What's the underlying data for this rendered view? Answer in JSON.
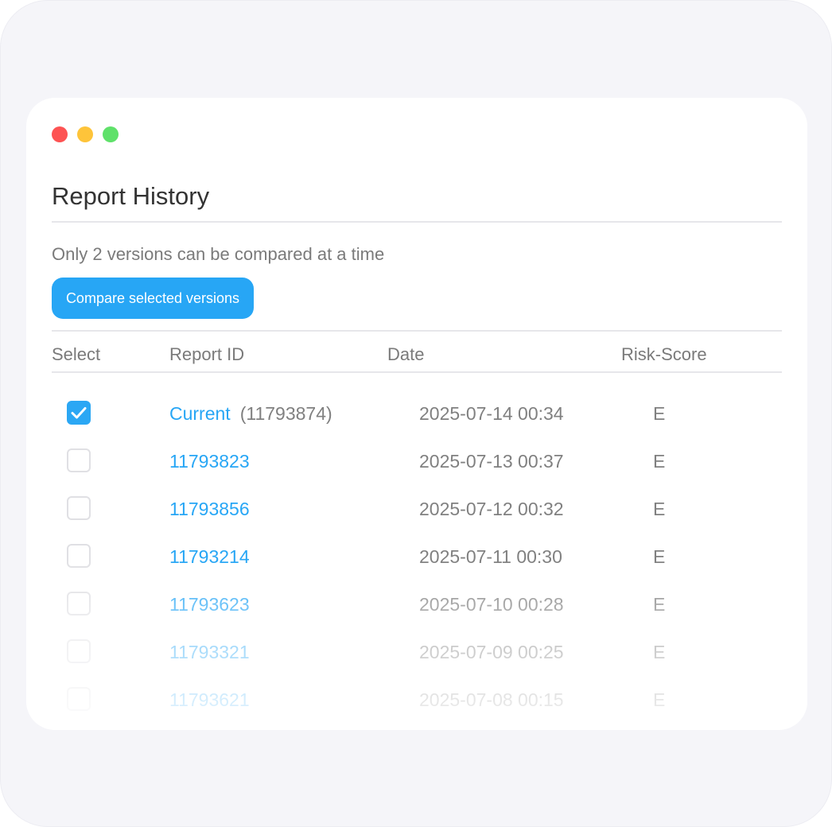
{
  "window": {
    "title": "Report History",
    "hint": "Only 2 versions can be compared at a time",
    "compare_button": "Compare selected versions"
  },
  "colors": {
    "accent": "#27a6f5",
    "close": "#fd5353",
    "minimize": "#fec43a",
    "maximize": "#5fe16a"
  },
  "table": {
    "headers": {
      "select": "Select",
      "report_id": "Report ID",
      "date": "Date",
      "risk_score": "Risk-Score"
    },
    "rows": [
      {
        "checked": true,
        "id": "Current",
        "id_extra": "(11793874)",
        "date": "2025-07-14 00:34",
        "score": "E"
      },
      {
        "checked": false,
        "id": "11793823",
        "date": "2025-07-13 00:37",
        "score": "E"
      },
      {
        "checked": false,
        "id": "11793856",
        "date": "2025-07-12 00:32",
        "score": "E"
      },
      {
        "checked": false,
        "id": "11793214",
        "date": "2025-07-11 00:30",
        "score": "E"
      },
      {
        "checked": false,
        "id": "11793623",
        "date": "2025-07-10 00:28",
        "score": "E"
      },
      {
        "checked": false,
        "id": "11793321",
        "date": "2025-07-09 00:25",
        "score": "E"
      },
      {
        "checked": false,
        "id": "11793621",
        "date": "2025-07-08 00:15",
        "score": "E"
      }
    ]
  }
}
